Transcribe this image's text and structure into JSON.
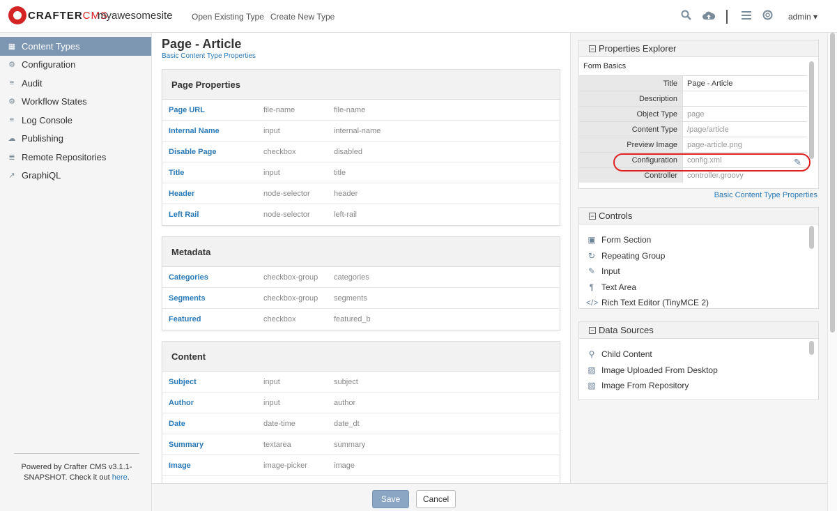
{
  "header": {
    "logo_text_a": "CRAFTER",
    "logo_text_b": "CMS",
    "site_name": "myawesomesite",
    "nav": [
      "Open Existing Type",
      "Create New Type"
    ],
    "user": "admin"
  },
  "sidebar": {
    "items": [
      {
        "label": "Content Types",
        "icon": "grid-icon",
        "glyph": "▦"
      },
      {
        "label": "Configuration",
        "icon": "gear-icon",
        "glyph": "⚙"
      },
      {
        "label": "Audit",
        "icon": "list-icon",
        "glyph": "≡"
      },
      {
        "label": "Workflow States",
        "icon": "gear-icon",
        "glyph": "⚙"
      },
      {
        "label": "Log Console",
        "icon": "list-icon",
        "glyph": "≡"
      },
      {
        "label": "Publishing",
        "icon": "cloud-upload-icon",
        "glyph": "☁"
      },
      {
        "label": "Remote Repositories",
        "icon": "database-icon",
        "glyph": "≣"
      },
      {
        "label": "GraphiQL",
        "icon": "line-chart-icon",
        "glyph": "↗"
      }
    ],
    "footer_text": "Powered by Crafter CMS v3.1.1-SNAPSHOT. Check it out",
    "footer_link": "here",
    "footer_end": "."
  },
  "main": {
    "title": "Page - Article",
    "subtitle": "Basic Content Type Properties",
    "sections": [
      {
        "title": "Page Properties",
        "fields": [
          {
            "label": "Page URL",
            "type": "file-name",
            "var": "file-name"
          },
          {
            "label": "Internal Name",
            "type": "input",
            "var": "internal-name"
          },
          {
            "label": "Disable Page",
            "type": "checkbox",
            "var": "disabled"
          },
          {
            "label": "Title",
            "type": "input",
            "var": "title"
          },
          {
            "label": "Header",
            "type": "node-selector",
            "var": "header"
          },
          {
            "label": "Left Rail",
            "type": "node-selector",
            "var": "left-rail"
          }
        ]
      },
      {
        "title": "Metadata",
        "fields": [
          {
            "label": "Categories",
            "type": "checkbox-group",
            "var": "categories"
          },
          {
            "label": "Segments",
            "type": "checkbox-group",
            "var": "segments"
          },
          {
            "label": "Featured",
            "type": "checkbox",
            "var": "featured_b"
          }
        ]
      },
      {
        "title": "Content",
        "fields": [
          {
            "label": "Subject",
            "type": "input",
            "var": "subject"
          },
          {
            "label": "Author",
            "type": "input",
            "var": "author"
          },
          {
            "label": "Date",
            "type": "date-time",
            "var": "date_dt"
          },
          {
            "label": "Summary",
            "type": "textarea",
            "var": "summary"
          },
          {
            "label": "Image",
            "type": "image-picker",
            "var": "image"
          }
        ]
      }
    ]
  },
  "properties_explorer": {
    "title": "Properties Explorer",
    "group": "Form Basics",
    "rows": [
      {
        "key": "Title",
        "value": "Page - Article",
        "dark": true
      },
      {
        "key": "Description",
        "value": "",
        "dark": false
      },
      {
        "key": "Object Type",
        "value": "page",
        "dark": false
      },
      {
        "key": "Content Type",
        "value": "/page/article",
        "dark": false
      },
      {
        "key": "Preview Image",
        "value": "page-article.png",
        "dark": false
      },
      {
        "key": "Configuration",
        "value": "config.xml",
        "dark": false
      },
      {
        "key": "Controller",
        "value": "controller.groovy",
        "dark": false
      }
    ],
    "link": "Basic Content Type Properties"
  },
  "controls": {
    "title": "Controls",
    "items": [
      {
        "label": "Form Section",
        "icon": "form-section-icon",
        "glyph": "▣"
      },
      {
        "label": "Repeating Group",
        "icon": "refresh-icon",
        "glyph": "↻"
      },
      {
        "label": "Input",
        "icon": "edit-icon",
        "glyph": "✎"
      },
      {
        "label": "Text Area",
        "icon": "paragraph-icon",
        "glyph": "¶"
      },
      {
        "label": "Rich Text Editor (TinyMCE 2)",
        "icon": "code-icon",
        "glyph": "</>"
      }
    ]
  },
  "data_sources": {
    "title": "Data Sources",
    "items": [
      {
        "label": "Child Content",
        "icon": "child-icon",
        "glyph": "⚲"
      },
      {
        "label": "Image Uploaded From Desktop",
        "icon": "image-icon",
        "glyph": "▨"
      },
      {
        "label": "Image From Repository",
        "icon": "image-file-icon",
        "glyph": "▧"
      }
    ]
  },
  "footer": {
    "save": "Save",
    "cancel": "Cancel"
  }
}
